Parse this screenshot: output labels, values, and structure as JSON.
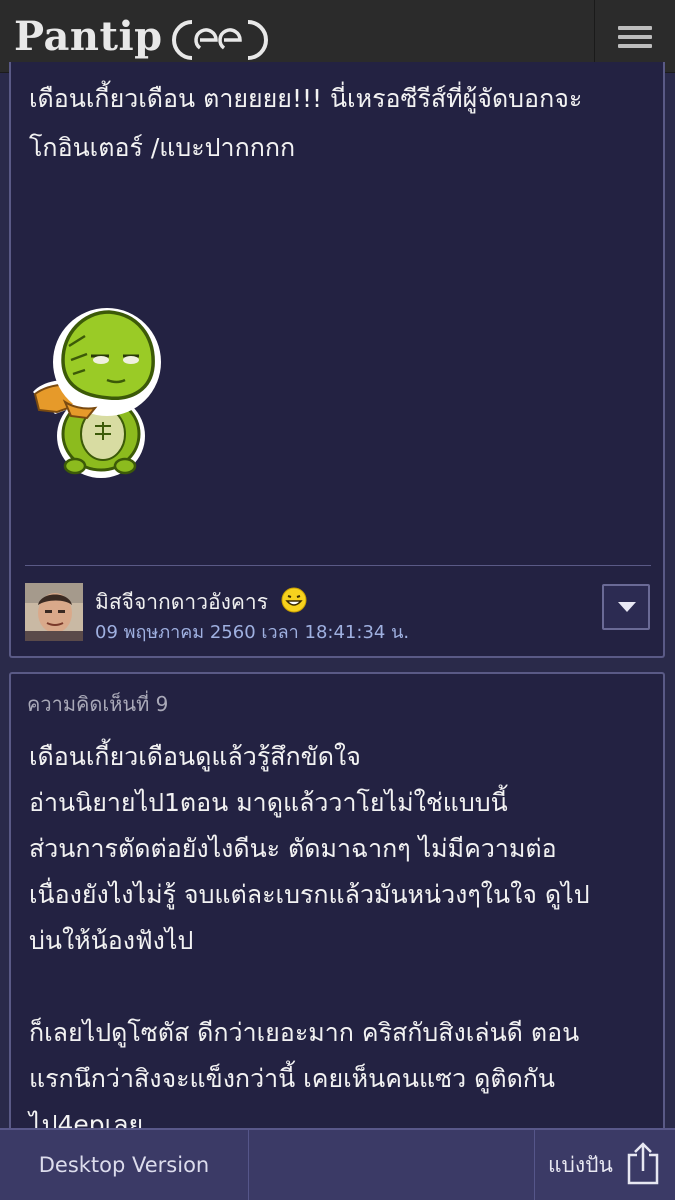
{
  "header": {
    "logo_text": "Pantip",
    "menu_icon": "hamburger-menu-icon"
  },
  "post": {
    "text": "เดือนเกี้ยวเดือน ตายยยย!!! นี่เหรอซีรีส์ที่ผู้จัดบอกจะ\nโกอินเตอร์ /แบะปากกกก",
    "sticker": "green-turtle-sticker",
    "author": "มิสจีจากดาวอังคาร",
    "author_emoji": "grinning-face-icon",
    "date": "09 พฤษภาคม 2560 เวลา 18:41:34 น."
  },
  "comment": {
    "label": "ความคิดเห็นที่ 9",
    "text": "เดือนเกี้ยวเดือนดูแล้วรู้สึกขัดใจ\nอ่านนิยายไป1ตอน มาดูแล้ววาโยไม่ใช่แบบนี้\nส่วนการตัดต่อยังไงดีนะ ตัดมาฉากๆ ไม่มีความต่อ\nเนื่องยังไงไม่รู้ จบแต่ละเบรกแล้วมันหน่วงๆในใจ ดูไป\nบ่นให้น้องฟังไป\n\nก็เลยไปดูโซตัส ดีกว่าเยอะมาก คริสกับสิงเล่นดี ตอน\nแรกนึกว่าสิงจะแข็งกว่านี้ เคยเห็นคนแซว ดูติดกัน\nไป4epเลย"
  },
  "bottom_bar": {
    "desktop_label": "Desktop Version",
    "share_label": "แบ่งปัน",
    "share_icon": "share-icon"
  },
  "colors": {
    "background": "#2a2a4a",
    "card": "#232242",
    "border": "#5a5a86",
    "date": "#9fb0e0"
  }
}
